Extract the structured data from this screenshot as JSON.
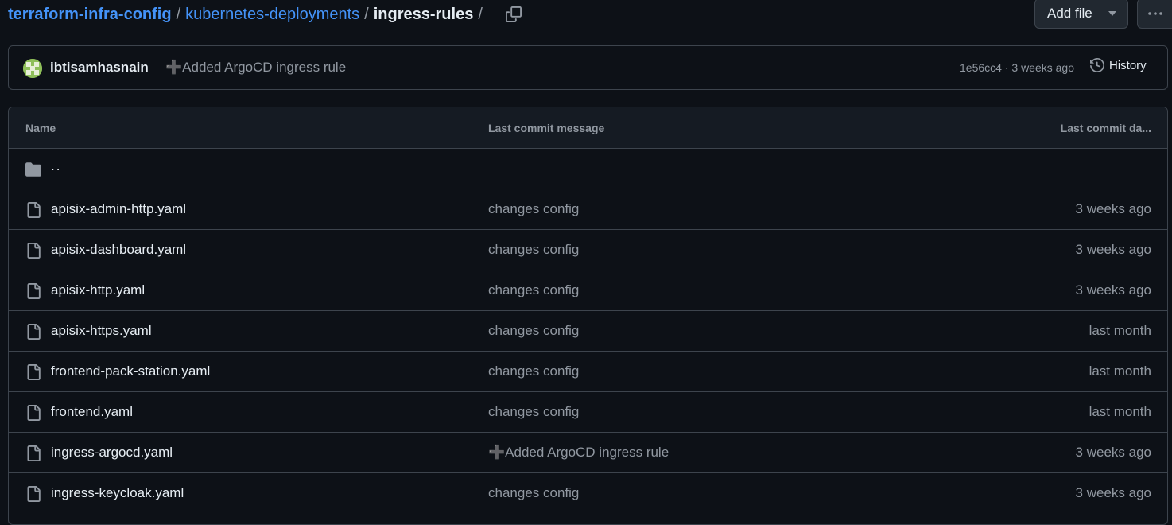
{
  "breadcrumb": {
    "repo": "terraform-infra-config",
    "folder": "kubernetes-deployments",
    "current": "ingress-rules",
    "sep": "/"
  },
  "toolbar": {
    "add_file_label": "Add file",
    "more_label": "···"
  },
  "commit": {
    "author": "ibtisamhasnain",
    "message": "➕Added ArgoCD ingress rule",
    "sha": "1e56cc4",
    "separator": "·",
    "when": "3 weeks ago",
    "history_label": "History"
  },
  "table": {
    "headers": {
      "name": "Name",
      "message": "Last commit message",
      "date": "Last commit da..."
    },
    "parent": "..",
    "rows": [
      {
        "name": "apisix-admin-http.yaml",
        "message": "changes config",
        "date": "3 weeks ago"
      },
      {
        "name": "apisix-dashboard.yaml",
        "message": "changes config",
        "date": "3 weeks ago"
      },
      {
        "name": "apisix-http.yaml",
        "message": "changes config",
        "date": "3 weeks ago"
      },
      {
        "name": "apisix-https.yaml",
        "message": "changes config",
        "date": "last month"
      },
      {
        "name": "frontend-pack-station.yaml",
        "message": "changes config",
        "date": "last month"
      },
      {
        "name": "frontend.yaml",
        "message": "changes config",
        "date": "last month"
      },
      {
        "name": "ingress-argocd.yaml",
        "message": "➕Added ArgoCD ingress rule",
        "date": "3 weeks ago"
      },
      {
        "name": "ingress-keycloak.yaml",
        "message": "changes config",
        "date": "3 weeks ago"
      }
    ]
  },
  "colors": {
    "background": "#0d1117",
    "link": "#4493f8",
    "border": "#3d444d",
    "muted": "#9198a1"
  }
}
